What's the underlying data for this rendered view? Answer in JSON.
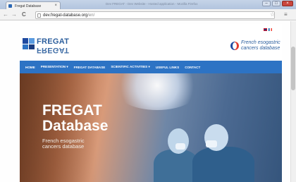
{
  "browser": {
    "tab_title": "Fregat Database",
    "tab_close": "×",
    "window_title": "Dev FREGAT - Dev Website - Hosted application - Mozilla Firefox",
    "address_host": "dev.fregat-database.org",
    "address_path": "/en/",
    "back_symbol": "←",
    "forward_symbol": "→",
    "reload_symbol": "C",
    "star_symbol": "☆",
    "menu_symbol": "≡",
    "win_min": "–",
    "win_max": "□",
    "win_close": "×"
  },
  "header": {
    "logo_text": "FREGAT",
    "tagline_line1": "French esogastric",
    "tagline_line2": "cancers database",
    "logo_colors": [
      "#1f4aa0",
      "#2d73c4",
      "#5a9be0",
      "#1b3c80"
    ]
  },
  "menu": {
    "items": [
      {
        "label": "HOME"
      },
      {
        "label": "PRESENTATION ▾"
      },
      {
        "label": "FREGAT DATABASE"
      },
      {
        "label": "SCIENTIFIC ACTIVITIES ▾"
      },
      {
        "label": "USEFUL LINKS"
      },
      {
        "label": "CONTACT"
      }
    ]
  },
  "hero": {
    "title_line1": "FREGAT",
    "title_line2": "Database",
    "subtitle_line1": "French esogastric",
    "subtitle_line2": "cancers database"
  },
  "colors": {
    "menu_bar": "#2d73c4",
    "brand_blue": "#2b5e9d"
  }
}
